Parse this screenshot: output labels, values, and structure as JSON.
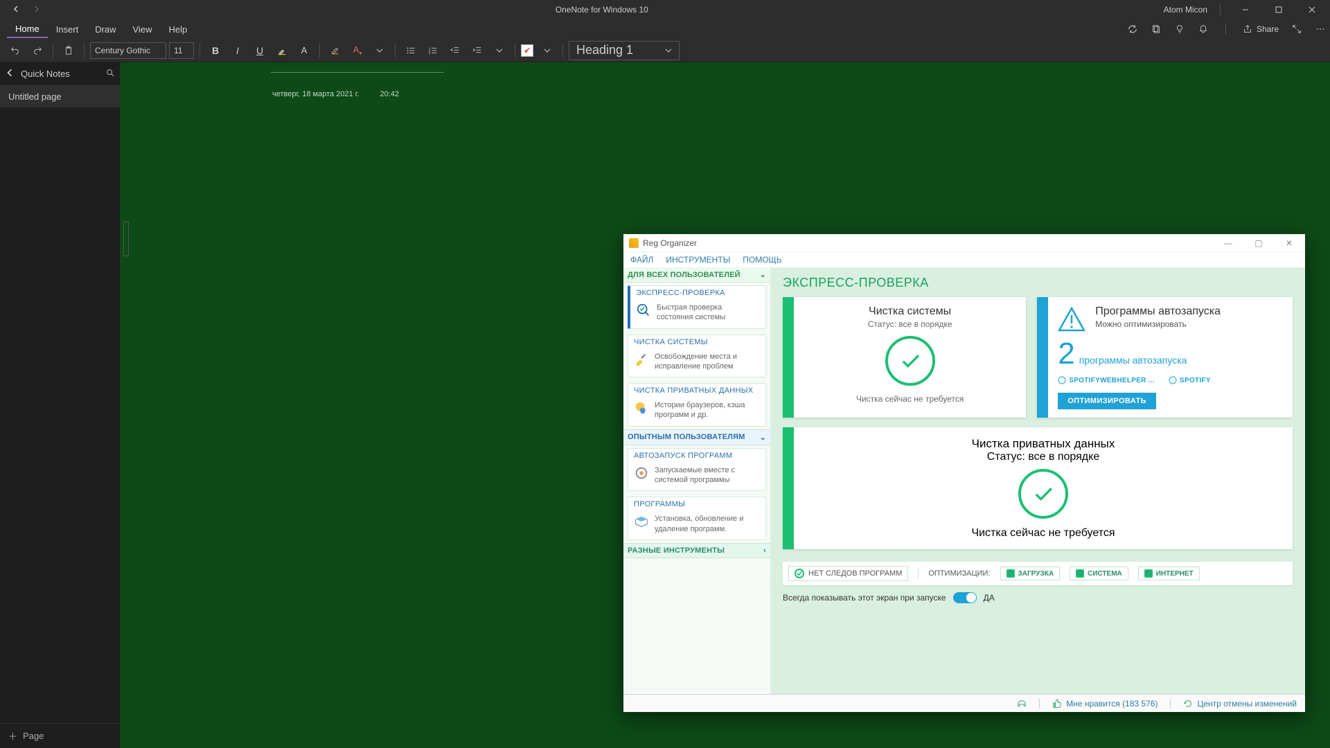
{
  "titlebar": {
    "app_title": "OneNote for Windows 10",
    "username": "Atom Micon"
  },
  "menubar": {
    "tabs": [
      "Home",
      "Insert",
      "Draw",
      "View",
      "Help"
    ],
    "share_label": "Share"
  },
  "ribbon": {
    "font_name": "Century Gothic",
    "font_size": "11",
    "heading_label": "Heading 1"
  },
  "sidebar": {
    "section_title": "Quick Notes",
    "page_item": "Untitled page",
    "add_page": "Page"
  },
  "page": {
    "date": "четверг, 18 марта 2021 г.",
    "time": "20:42"
  },
  "ro": {
    "title": "Reg Organizer",
    "menu": [
      "ФАЙЛ",
      "ИНСТРУМЕНТЫ",
      "ПОМОЩЬ"
    ],
    "sections": {
      "all_users": "ДЛЯ ВСЕХ ПОЛЬЗОВАТЕЛЕЙ",
      "advanced": "ОПЫТНЫМ ПОЛЬЗОВАТЕЛЯМ",
      "misc": "РАЗНЫЕ ИНСТРУМЕНТЫ"
    },
    "nav": {
      "express_title": "ЭКСПРЕСС-ПРОВЕРКА",
      "express_desc": "Быстрая проверка состояния системы",
      "clean_title": "ЧИСТКА СИСТЕМЫ",
      "clean_desc": "Освобождение места и исправление проблем",
      "private_title": "ЧИСТКА ПРИВАТНЫХ ДАННЫХ",
      "private_desc": "Истории браузеров, кэша программ и др.",
      "autorun_title": "АВТОЗАПУСК ПРОГРАММ",
      "autorun_desc": "Запускаемые вместе с системой программы",
      "programs_title": "ПРОГРАММЫ",
      "programs_desc": "Установка, обновление и удаление программ."
    },
    "right": {
      "header": "ЭКСПРЕСС-ПРОВЕРКА",
      "card1_title": "Чистка системы",
      "card1_status": "Статус: все в порядке",
      "card1_foot": "Чистка сейчас не требуется",
      "card2_title": "Программы автозапуска",
      "card2_status": "Можно оптимизировать",
      "card2_count": "2",
      "card2_sub": "программы автозапуска",
      "card2_prog1": "SPOTIFYWEBHELPER ...",
      "card2_prog2": "SPOTIFY",
      "card2_btn": "ОПТИМИЗИРОВАТЬ",
      "card3_title": "Чистка приватных данных",
      "card3_status": "Статус: все в порядке",
      "card3_foot": "Чистка сейчас не требуется",
      "no_traces": "НЕТ СЛЕДОВ ПРОГРАММ",
      "opt_label": "ОПТИМИЗАЦИИ:",
      "chips": [
        "ЗАГРУЗКА",
        "СИСТЕМА",
        "ИНТЕРНЕТ"
      ],
      "always_show": "Всегда показывать этот экран при запуске",
      "toggle_yes": "ДА"
    },
    "status": {
      "like": "Мне нравится (183 576)",
      "undo": "Центр отмены изменений"
    }
  }
}
